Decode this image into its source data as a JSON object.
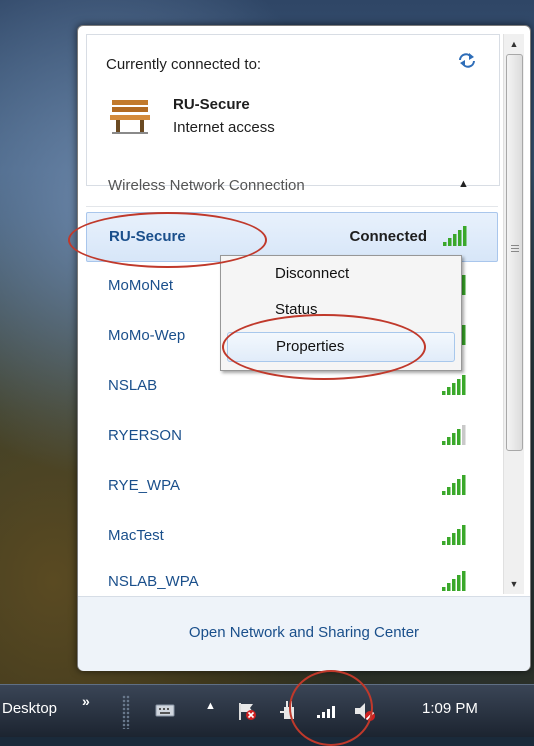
{
  "current": {
    "label": "Currently connected to:",
    "name": "RU-Secure",
    "access": "Internet access"
  },
  "section": {
    "label": "Wireless Network Connection"
  },
  "networks": [
    {
      "name": "RU-Secure",
      "status": "Connected",
      "bars": 5
    },
    {
      "name": "MoMoNet",
      "status": "",
      "bars": 5
    },
    {
      "name": "MoMo-Wep",
      "status": "",
      "bars": 5
    },
    {
      "name": "NSLAB",
      "status": "",
      "bars": 5
    },
    {
      "name": "RYERSON",
      "status": "",
      "bars": 4
    },
    {
      "name": "RYE_WPA",
      "status": "",
      "bars": 5
    },
    {
      "name": "MacTest",
      "status": "",
      "bars": 5
    },
    {
      "name": "NSLAB_WPA",
      "status": "",
      "bars": 5
    }
  ],
  "context_menu": {
    "items": [
      "Disconnect",
      "Status",
      "Properties"
    ],
    "highlighted": "Properties"
  },
  "footer": {
    "link": "Open Network and Sharing Center"
  },
  "taskbar": {
    "toolbar": "Desktop",
    "chevron": "»",
    "clock": "1:09 PM"
  },
  "colors": {
    "link": "#1a4f8b",
    "signal": "#3aa82a",
    "annotation": "#c0392b",
    "selection": "#d7e6f8"
  }
}
